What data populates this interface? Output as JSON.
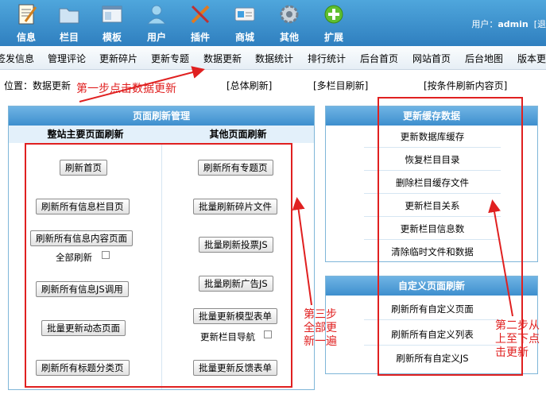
{
  "toolbar": {
    "items": [
      {
        "label": "信息",
        "icon": "document-edit-icon"
      },
      {
        "label": "栏目",
        "icon": "folder-icon"
      },
      {
        "label": "模板",
        "icon": "template-window-icon"
      },
      {
        "label": "用户",
        "icon": "user-icon"
      },
      {
        "label": "插件",
        "icon": "tools-icon"
      },
      {
        "label": "商城",
        "icon": "shop-card-icon"
      },
      {
        "label": "其他",
        "icon": "gear-icon"
      },
      {
        "label": "扩展",
        "icon": "plus-icon"
      }
    ],
    "user_prefix": "用户：",
    "user_name": "admin",
    "user_suffix": "[退"
  },
  "menu": {
    "items": [
      "签发信息",
      "管理评论",
      "更新碎片",
      "更新专题",
      "数据更新",
      "数据统计",
      "排行统计",
      "后台首页",
      "网站首页",
      "后台地图",
      "版本更"
    ]
  },
  "breadcrumb": {
    "prefix": "位置：",
    "current": "数据更新",
    "links": [
      "[总体刷新]",
      "[多栏目刷新]",
      "[按条件刷新内容页]"
    ]
  },
  "left_panel": {
    "title": "页面刷新管理",
    "col_main_title": "整站主要页面刷新",
    "col_other_title": "其他页面刷新",
    "main_buttons": [
      "刷新首页",
      "刷新所有信息栏目页",
      "刷新所有信息内容页面",
      "刷新所有信息JS调用",
      "批量更新动态页面",
      "刷新所有标题分类页"
    ],
    "main_checkbox_label": "全部刷新",
    "other_buttons": [
      "刷新所有专题页",
      "批量刷新碎片文件",
      "批量刷新投票JS",
      "批量刷新广告JS",
      "批量更新模型表单",
      "批量更新反馈表单"
    ],
    "other_checkbox_label": "更新栏目导航"
  },
  "cache_panel": {
    "title": "更新缓存数据",
    "links": [
      "更新数据库缓存",
      "恢复栏目目录",
      "删除栏目缓存文件",
      "更新栏目关系",
      "更新栏目信息数",
      "清除临时文件和数据"
    ]
  },
  "custom_panel": {
    "title": "自定义页面刷新",
    "links": [
      "刷新所有自定义页面",
      "刷新所有自定义列表",
      "刷新所有自定义JS"
    ]
  },
  "annotations": {
    "step1": "第一步点击数据更新",
    "step2_lines": [
      "第二步从",
      "上至下点",
      "击更新"
    ],
    "step3_lines": [
      "第三步",
      "全部更",
      "新一遍"
    ]
  },
  "colors": {
    "toolbar_blue": "#3a8ccc",
    "annotation_red": "#e02020"
  }
}
